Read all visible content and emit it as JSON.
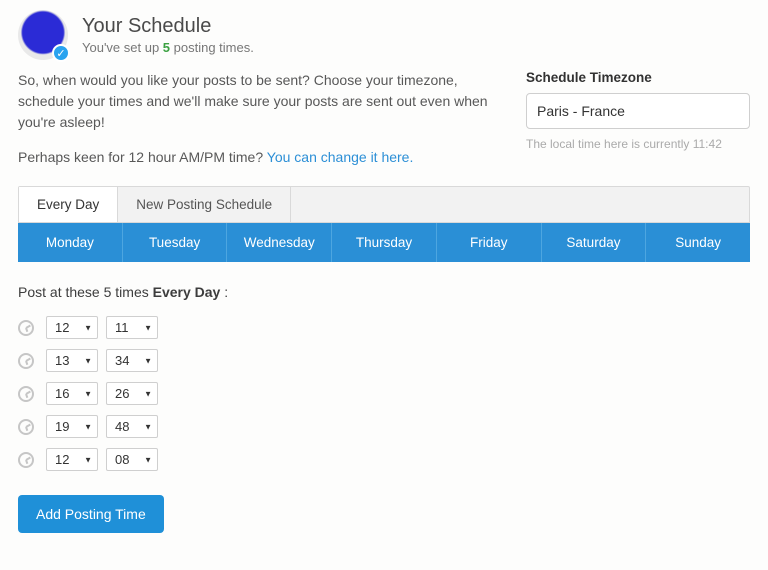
{
  "header": {
    "title": "Your Schedule",
    "subtitle_prefix": "You've set up ",
    "count": "5",
    "subtitle_suffix": " posting times."
  },
  "intro": {
    "p1": "So, when would you like your posts to be sent? Choose your timezone, schedule your times and we'll make sure your posts are sent out even when you're asleep!",
    "p2_prefix": "Perhaps keen for 12 hour AM/PM time? ",
    "p2_link": "You can change it here."
  },
  "timezone": {
    "label": "Schedule Timezone",
    "value": "Paris - France",
    "hint": "The local time here is currently 11:42"
  },
  "tabs": {
    "everyday": "Every Day",
    "newschedule": "New Posting Schedule"
  },
  "days": [
    "Monday",
    "Tuesday",
    "Wednesday",
    "Thursday",
    "Friday",
    "Saturday",
    "Sunday"
  ],
  "post_heading_prefix": "Post at these 5 times ",
  "post_heading_strong": "Every Day",
  "post_heading_suffix": " :",
  "times": [
    {
      "hour": "12",
      "minute": "11"
    },
    {
      "hour": "13",
      "minute": "34"
    },
    {
      "hour": "16",
      "minute": "26"
    },
    {
      "hour": "19",
      "minute": "48"
    },
    {
      "hour": "12",
      "minute": "08"
    }
  ],
  "add_button": "Add Posting Time"
}
